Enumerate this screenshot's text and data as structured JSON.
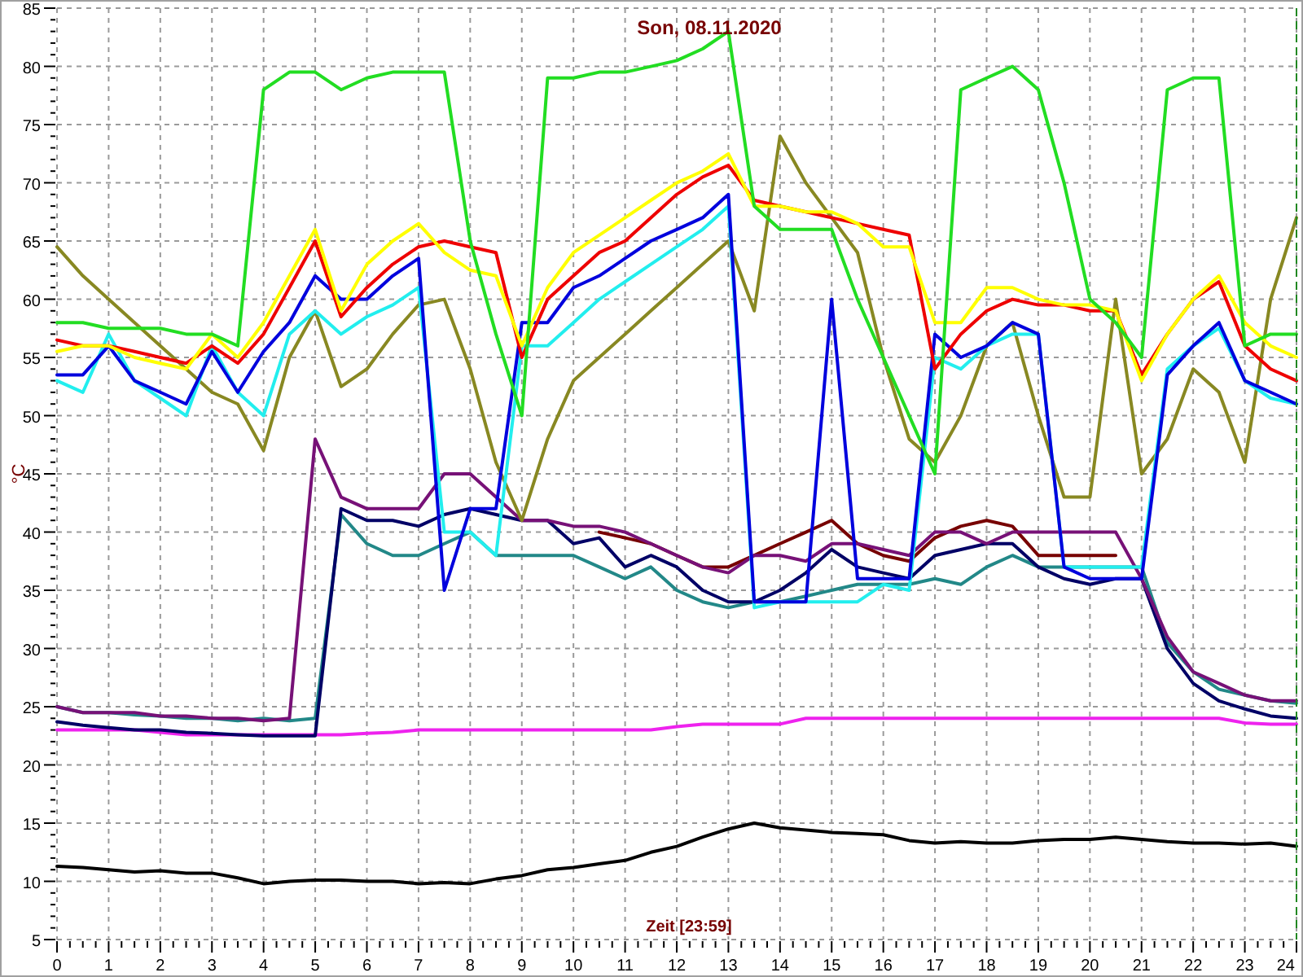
{
  "chart_data": {
    "type": "line",
    "title": "Son, 08.11.2020",
    "xlabel": "Zeit [23:59]",
    "ylabel": "°C",
    "grid": true,
    "xlim": [
      0,
      24
    ],
    "ylim": [
      5,
      85
    ],
    "xticks": [
      0,
      1,
      2,
      3,
      4,
      5,
      6,
      7,
      8,
      9,
      10,
      11,
      12,
      13,
      14,
      15,
      16,
      17,
      18,
      19,
      20,
      21,
      22,
      23,
      24
    ],
    "yticks": [
      5,
      10,
      15,
      20,
      25,
      30,
      35,
      40,
      45,
      50,
      55,
      60,
      65,
      70,
      75,
      80,
      85
    ],
    "x": [
      0,
      0.5,
      1,
      1.5,
      2,
      2.5,
      3,
      3.5,
      4,
      4.5,
      5,
      5.5,
      6,
      6.5,
      7,
      7.5,
      8,
      8.5,
      9,
      9.5,
      10,
      10.5,
      11,
      11.5,
      12,
      12.5,
      13,
      13.5,
      14,
      14.5,
      15,
      15.5,
      16,
      16.5,
      17,
      17.5,
      18,
      18.5,
      19,
      19.5,
      20,
      20.5,
      21,
      21.5,
      22,
      22.5,
      23,
      23.5,
      24
    ],
    "series": [
      {
        "color": "#000000",
        "values": [
          11.3,
          11.2,
          11,
          10.8,
          10.9,
          10.7,
          10.7,
          10.3,
          9.8,
          10,
          10.1,
          10.1,
          10,
          10,
          9.8,
          9.9,
          9.8,
          10.2,
          10.5,
          11,
          11.2,
          11.5,
          11.8,
          12.5,
          13,
          13.8,
          14.5,
          15,
          14.6,
          14.4,
          14.2,
          14.1,
          14,
          13.5,
          13.3,
          13.4,
          13.3,
          13.3,
          13.5,
          13.6,
          13.6,
          13.8,
          13.6,
          13.4,
          13.3,
          13.3,
          13.2,
          13.3,
          13
        ]
      },
      {
        "color": "#ee22ee",
        "values": [
          23,
          23,
          23,
          23,
          22.8,
          22.6,
          22.6,
          22.6,
          22.6,
          22.6,
          22.6,
          22.6,
          22.7,
          22.8,
          23,
          23,
          23,
          23,
          23,
          23,
          23,
          23,
          23,
          23,
          23.3,
          23.5,
          23.5,
          23.5,
          23.5,
          24,
          24,
          24,
          24,
          24,
          24,
          24,
          24,
          24,
          24,
          24,
          24,
          24,
          24,
          24,
          24,
          24,
          23.6,
          23.5,
          23.5
        ]
      },
      {
        "color": "#228888",
        "values": [
          25,
          24.5,
          24.5,
          24.3,
          24.2,
          24,
          24,
          23.8,
          24,
          23.8,
          24,
          41.5,
          39,
          38,
          38,
          39,
          40,
          38,
          38,
          38,
          38,
          37,
          36,
          37,
          35,
          34,
          33.5,
          34,
          34,
          34.5,
          35,
          35.5,
          35.5,
          35.5,
          36,
          35.5,
          37,
          38,
          37,
          37,
          37,
          37,
          37,
          30.5,
          28,
          26.5,
          26,
          25.5,
          25.3
        ]
      },
      {
        "color": "#000066",
        "values": [
          23.7,
          23.4,
          23.2,
          23,
          23,
          22.8,
          22.7,
          22.6,
          22.5,
          22.5,
          22.5,
          42,
          41,
          41,
          40.5,
          41.5,
          42,
          41.5,
          41,
          41,
          39,
          39.5,
          37,
          38,
          37,
          35,
          34,
          34,
          35,
          36.5,
          38.5,
          37,
          36.5,
          36,
          38,
          38.5,
          39,
          39,
          37,
          36,
          35.5,
          36,
          36,
          30,
          27,
          25.5,
          24.8,
          24.2,
          24
        ]
      },
      {
        "color": "#770000",
        "values": [
          null,
          null,
          null,
          null,
          null,
          null,
          null,
          null,
          null,
          null,
          null,
          null,
          null,
          null,
          null,
          null,
          null,
          null,
          null,
          null,
          null,
          40,
          39.5,
          39,
          38,
          37,
          37,
          38,
          39,
          40,
          41,
          39,
          38,
          37.5,
          39.5,
          40.5,
          41,
          40.5,
          38,
          38,
          38,
          38,
          null,
          null,
          null,
          null,
          null,
          null,
          null
        ]
      },
      {
        "color": "#771177",
        "values": [
          25,
          24.5,
          24.5,
          24.5,
          24.2,
          24.2,
          24,
          24,
          23.8,
          24,
          48,
          43,
          42,
          42,
          42,
          45,
          45,
          43,
          41,
          41,
          40.5,
          40.5,
          40,
          39,
          38,
          37,
          36.5,
          38,
          38,
          37.5,
          39,
          39,
          38.5,
          38,
          40,
          40,
          39,
          40,
          40,
          40,
          40,
          40,
          36,
          31,
          28,
          27,
          26,
          25.5,
          25.5
        ]
      },
      {
        "color": "#888822",
        "values": [
          64.5,
          62,
          60,
          58,
          56,
          54,
          52,
          51,
          47,
          55,
          59,
          52.5,
          54,
          57,
          59.5,
          60,
          54,
          46,
          41,
          48,
          53,
          55,
          57,
          59,
          61,
          63,
          65,
          59,
          74,
          70,
          67,
          64,
          55,
          48,
          46,
          50,
          56,
          58,
          50,
          43,
          43,
          60,
          45,
          48,
          54,
          52,
          46,
          60,
          67
        ]
      },
      {
        "color": "#22eeee",
        "values": [
          53,
          52,
          57,
          53,
          51.5,
          50,
          56,
          52,
          50,
          57,
          59,
          57,
          58.5,
          59.5,
          61,
          40,
          40,
          38,
          56,
          56,
          58,
          60,
          61.5,
          63,
          64.5,
          66,
          68,
          33.5,
          34,
          34,
          34,
          34,
          35.5,
          35,
          55,
          54,
          56,
          57,
          57,
          37,
          37,
          37,
          37,
          54,
          56,
          57.5,
          53,
          51.5,
          51
        ]
      },
      {
        "color": "#0000dd",
        "values": [
          53.5,
          53.5,
          56,
          53,
          52,
          51,
          55.5,
          52,
          55.5,
          58,
          62,
          60,
          60,
          62,
          63.5,
          35,
          42,
          42,
          58,
          58,
          61,
          62,
          63.5,
          65,
          66,
          67,
          69,
          34,
          34,
          34,
          60,
          36,
          36,
          36,
          57,
          55,
          56,
          58,
          57,
          37,
          36,
          36,
          36,
          53.5,
          56,
          58,
          53,
          52,
          51
        ]
      },
      {
        "color": "#ee0000",
        "values": [
          56.5,
          56,
          56,
          55.5,
          55,
          54.5,
          56,
          54.5,
          57,
          61,
          65,
          58.5,
          61,
          63,
          64.5,
          65,
          64.5,
          64,
          55,
          60,
          62,
          64,
          65,
          67,
          69,
          70.5,
          71.5,
          68.5,
          68,
          67.5,
          67,
          66.5,
          66,
          65.5,
          54,
          57,
          59,
          60,
          59.5,
          59.5,
          59,
          59,
          53.5,
          57,
          60,
          61.5,
          56,
          54,
          53
        ]
      },
      {
        "color": "#ffff00",
        "values": [
          55.5,
          56,
          56,
          55,
          54.5,
          54,
          57,
          55,
          58,
          62,
          66,
          59,
          63,
          65,
          66.5,
          64,
          62.5,
          62,
          56,
          61,
          64,
          65.5,
          67,
          68.5,
          70,
          71,
          72.5,
          68,
          68,
          67.5,
          67.5,
          66.5,
          64.5,
          64.5,
          58,
          58,
          61,
          61,
          60,
          59.5,
          59.5,
          59,
          53,
          57,
          60,
          62,
          58,
          56,
          55
        ]
      },
      {
        "color": "#22dd22",
        "values": [
          58,
          58,
          57.5,
          57.5,
          57.5,
          57,
          57,
          56,
          78,
          79.5,
          79.5,
          78,
          79,
          79.5,
          79.5,
          79.5,
          65,
          57,
          50,
          79,
          79,
          79.5,
          79.5,
          80,
          80.5,
          81.5,
          83,
          68,
          66,
          66,
          66,
          60,
          55,
          50,
          45,
          78,
          79,
          80,
          78,
          70,
          60,
          58,
          55,
          78,
          79,
          79,
          56,
          57,
          57
        ]
      }
    ]
  }
}
